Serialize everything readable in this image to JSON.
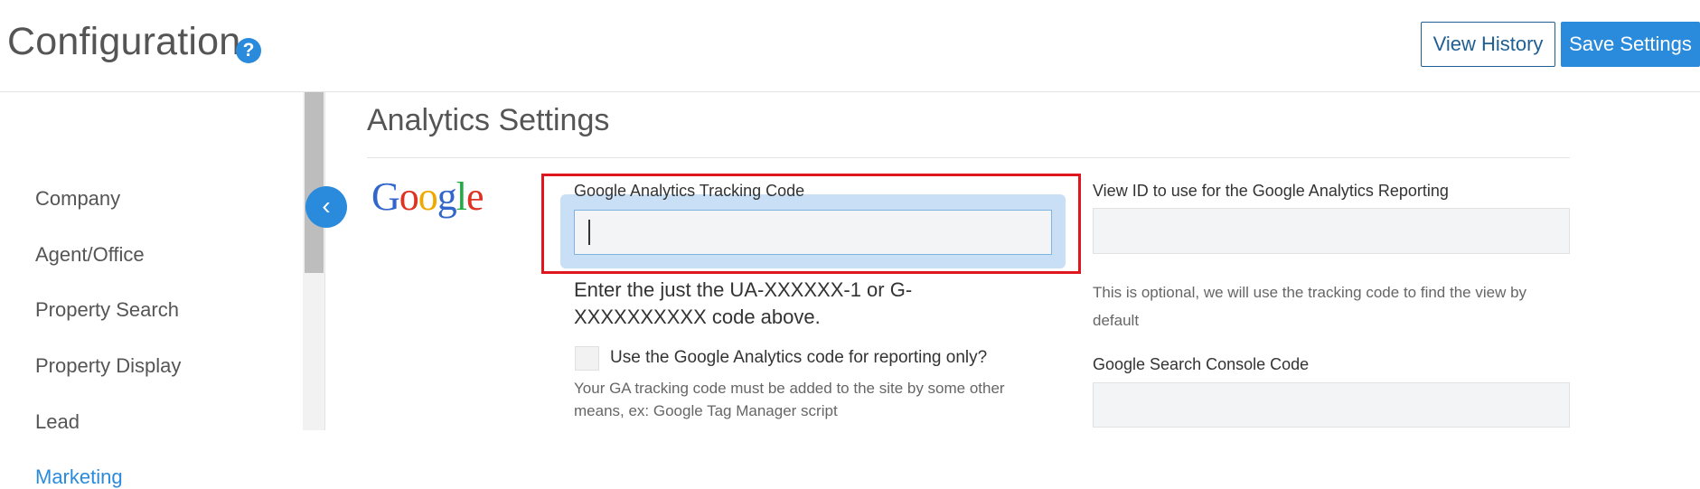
{
  "header": {
    "title": "Configuration",
    "help_icon": "?",
    "view_history_label": "View History",
    "save_label": "Save Settings"
  },
  "sidebar": {
    "items": [
      {
        "label": "Company"
      },
      {
        "label": "Agent/Office"
      },
      {
        "label": "Property Search"
      },
      {
        "label": "Property Display"
      },
      {
        "label": "Lead"
      },
      {
        "label": "Marketing",
        "active": true
      }
    ],
    "collapse_icon": "‹"
  },
  "main": {
    "section_title": "Analytics Settings",
    "google_logo": [
      "G",
      "o",
      "o",
      "g",
      "l",
      "e"
    ],
    "tracking": {
      "label": "Google Analytics Tracking Code",
      "value": "",
      "help": "Enter the just the UA-XXXXXX-1 or G-XXXXXXXXXX code above."
    },
    "reporting_only": {
      "label": "Use the Google Analytics code for reporting only?",
      "checked": false,
      "help": "Your GA tracking code must be added to the site by some other means, ex: Google Tag Manager script"
    },
    "view_id": {
      "label": "View ID to use for the Google Analytics Reporting",
      "value": "",
      "help": "This is optional, we will use the tracking code to find the view by default"
    },
    "search_console": {
      "label": "Google Search Console Code",
      "value": ""
    }
  },
  "colors": {
    "accent": "#2a8bdc",
    "highlight": "#e0161e",
    "google_blue": "#3366cc",
    "google_red": "#dd3322",
    "google_yellow": "#eeaa00",
    "google_green": "#22aa44"
  }
}
